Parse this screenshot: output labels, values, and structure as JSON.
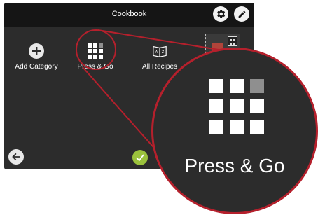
{
  "topbar": {
    "title": "Cookbook"
  },
  "tiles": [
    {
      "label": "Add Category",
      "icon": "plus-icon"
    },
    {
      "label": "Press & Go",
      "icon": "grid-icon"
    },
    {
      "label": "All Recipes",
      "icon": "book-az-icon"
    }
  ],
  "magnifier": {
    "label": "Press & Go",
    "icon": "grid-icon"
  },
  "colors": {
    "screen_bg": "#2c2c2c",
    "topbar_bg": "#151515",
    "callout": "#b5202c",
    "confirm": "#9bc23c"
  },
  "icons": {
    "top_right": [
      "gear-icon",
      "pencil-icon"
    ],
    "bottom": [
      "back-arrow-icon",
      "checkmark-icon"
    ]
  }
}
